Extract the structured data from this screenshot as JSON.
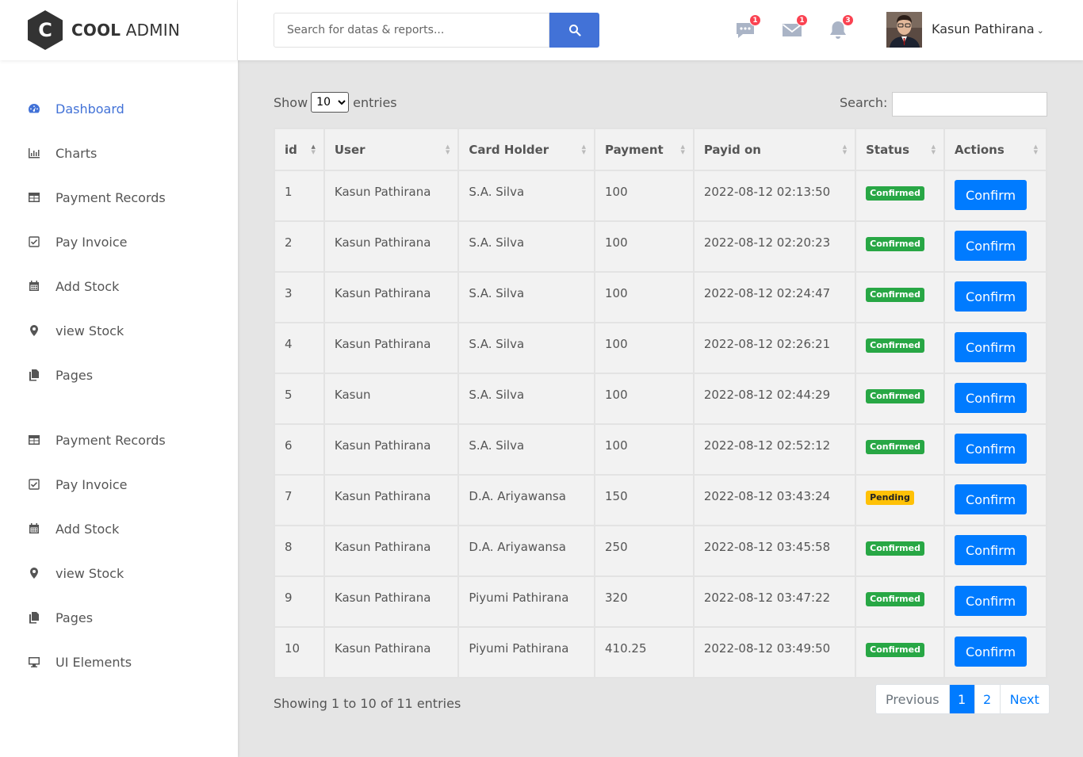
{
  "brand": {
    "bold": "COOL",
    "rest": "ADMIN",
    "letter": "C"
  },
  "sidebar": {
    "items": [
      {
        "label": "Dashboard",
        "icon": "dashboard-icon"
      },
      {
        "label": "Charts",
        "icon": "bar-chart-icon"
      },
      {
        "label": "Payment Records",
        "icon": "table-icon"
      },
      {
        "label": "Pay Invoice",
        "icon": "check-square-icon"
      },
      {
        "label": "Add Stock",
        "icon": "calendar-icon"
      },
      {
        "label": "view Stock",
        "icon": "map-marker-icon"
      },
      {
        "label": "Pages",
        "icon": "copy-icon"
      },
      {
        "label": "Payment Records",
        "icon": "table-icon"
      },
      {
        "label": "Pay Invoice",
        "icon": "check-square-icon"
      },
      {
        "label": "Add Stock",
        "icon": "calendar-icon"
      },
      {
        "label": "view Stock",
        "icon": "map-marker-icon"
      },
      {
        "label": "Pages",
        "icon": "copy-icon"
      },
      {
        "label": "UI Elements",
        "icon": "desktop-icon"
      }
    ]
  },
  "header": {
    "search_placeholder": "Search for datas & reports...",
    "notifications": {
      "comments": "1",
      "mail": "1",
      "bell": "3"
    },
    "user_name": "Kasun Pathirana"
  },
  "table_controls": {
    "show_label": "Show",
    "entries_label": "entries",
    "page_size": "10",
    "search_label": "Search:"
  },
  "table": {
    "columns": [
      "id",
      "User",
      "Card Holder",
      "Payment",
      "Payid on",
      "Status",
      "Actions"
    ],
    "rows": [
      {
        "id": "1",
        "user": "Kasun Pathirana",
        "holder": "S.A. Silva",
        "payment": "100",
        "payid": "2022-08-12 02:13:50",
        "status": "Confirmed",
        "action": "Confirm"
      },
      {
        "id": "2",
        "user": "Kasun Pathirana",
        "holder": "S.A. Silva",
        "payment": "100",
        "payid": "2022-08-12 02:20:23",
        "status": "Confirmed",
        "action": "Confirm"
      },
      {
        "id": "3",
        "user": "Kasun Pathirana",
        "holder": "S.A. Silva",
        "payment": "100",
        "payid": "2022-08-12 02:24:47",
        "status": "Confirmed",
        "action": "Confirm"
      },
      {
        "id": "4",
        "user": "Kasun Pathirana",
        "holder": "S.A. Silva",
        "payment": "100",
        "payid": "2022-08-12 02:26:21",
        "status": "Confirmed",
        "action": "Confirm"
      },
      {
        "id": "5",
        "user": "Kasun",
        "holder": "S.A. Silva",
        "payment": "100",
        "payid": "2022-08-12 02:44:29",
        "status": "Confirmed",
        "action": "Confirm"
      },
      {
        "id": "6",
        "user": "Kasun Pathirana",
        "holder": "S.A. Silva",
        "payment": "100",
        "payid": "2022-08-12 02:52:12",
        "status": "Confirmed",
        "action": "Confirm"
      },
      {
        "id": "7",
        "user": "Kasun Pathirana",
        "holder": "D.A. Ariyawansa",
        "payment": "150",
        "payid": "2022-08-12 03:43:24",
        "status": "Pending",
        "action": "Confirm"
      },
      {
        "id": "8",
        "user": "Kasun Pathirana",
        "holder": "D.A. Ariyawansa",
        "payment": "250",
        "payid": "2022-08-12 03:45:58",
        "status": "Confirmed",
        "action": "Confirm"
      },
      {
        "id": "9",
        "user": "Kasun Pathirana",
        "holder": "Piyumi Pathirana",
        "payment": "320",
        "payid": "2022-08-12 03:47:22",
        "status": "Confirmed",
        "action": "Confirm"
      },
      {
        "id": "10",
        "user": "Kasun Pathirana",
        "holder": "Piyumi Pathirana",
        "payment": "410.25",
        "payid": "2022-08-12 03:49:50",
        "status": "Confirmed",
        "action": "Confirm"
      }
    ]
  },
  "footer": {
    "info": "Showing 1 to 10 of 11 entries",
    "pagination": {
      "previous": "Previous",
      "page1": "1",
      "page2": "2",
      "next": "Next"
    }
  },
  "colors": {
    "accent": "#4272d7",
    "primary_button": "#007bff",
    "confirmed": "#28a745",
    "pending": "#ffc107",
    "badge": "#fa4251"
  }
}
